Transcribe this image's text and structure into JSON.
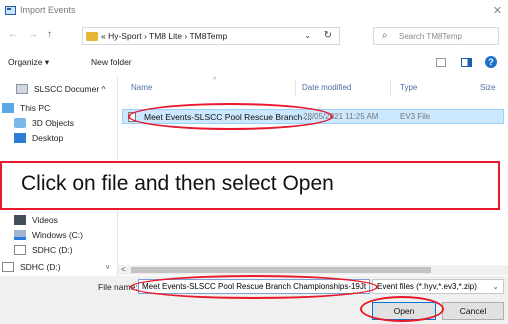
{
  "window": {
    "title": "Import Events",
    "close_glyph": "✕",
    "app_icon": "dialog-icon"
  },
  "nav": {
    "back": "←",
    "forward": "→",
    "up": "↑"
  },
  "address": {
    "prefix": "«",
    "crumbs": [
      "Hy-Sport",
      "TM8 Lite",
      "TM8Temp"
    ],
    "crumb_text": "« Hy-Sport  ›  TM8 Lite  ›  TM8Temp",
    "dropdown_glyph": "⌄",
    "refresh_glyph": "↻"
  },
  "search": {
    "placeholder": "Search TM8Temp",
    "icon_glyph": "⌕"
  },
  "toolbar": {
    "organize": "Organize ▾",
    "new_folder": "New folder",
    "help": "?"
  },
  "navpane": {
    "items": [
      {
        "label": "SLSCC Documer ^",
        "icon": "drive-icon"
      },
      {
        "label": "This PC",
        "icon": "pc-icon"
      },
      {
        "label": "3D Objects",
        "icon": "3d-objects-icon"
      },
      {
        "label": "Desktop",
        "icon": "desktop-icon"
      },
      {
        "label": "Videos",
        "icon": "videos-icon"
      },
      {
        "label": "Windows (C:)",
        "icon": "windows-drive-icon"
      },
      {
        "label": "SDHC (D:)",
        "icon": "sd-card-icon"
      },
      {
        "label": "SDHC (D:)",
        "icon": "sd-card-icon"
      }
    ],
    "scroll_down": "v"
  },
  "columns": {
    "name": "Name",
    "date": "Date modified",
    "type": "Type",
    "size": "Size",
    "sort_glyph": "^"
  },
  "files": [
    {
      "name": "Meet Events-SLSCC Pool Rescue Branch ...",
      "date": "28/05/2021 11:25 AM",
      "type": "EV3 File"
    }
  ],
  "hscroll": {
    "left_arrow": "<"
  },
  "footer": {
    "file_name_label": "File name:",
    "file_name_value": "Meet Events-SLSCC Pool Rescue Branch Championships-19Jt",
    "file_type": "Event files (*.hyv,*.ev3,*.zip)",
    "file_type_caret": "⌄",
    "open_label": "Open",
    "cancel_label": "Cancel"
  },
  "overlay": {
    "text": "Click on file and then select Open"
  },
  "colors": {
    "annotation": "#e8192c",
    "selection": "#cce8ff",
    "accent": "#0078d7"
  }
}
